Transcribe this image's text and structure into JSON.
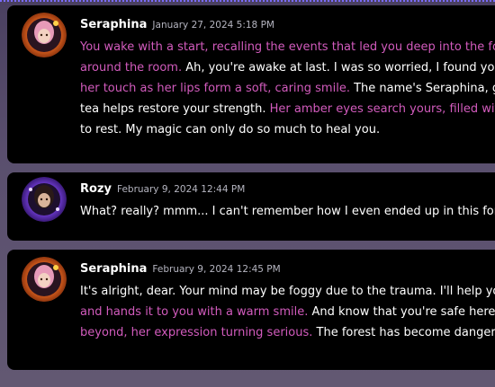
{
  "messages": [
    {
      "author": "Seraphina",
      "timestamp": "January 27, 2024 5:18 PM",
      "avatar": "avatar-seraphina",
      "lines": [
        [
          {
            "style": "pink",
            "text": "You wake with a start, recalling the events that led you deep into the for"
          }
        ],
        [
          {
            "style": "pink",
            "text": "around the room. "
          },
          {
            "style": "white",
            "text": "Ah, you're awake at last. I was so worried, I found you b"
          }
        ],
        [
          {
            "style": "pink",
            "text": "her touch as her lips form a soft, caring smile. "
          },
          {
            "style": "white",
            "text": "The name's Seraphina, gu"
          }
        ],
        [
          {
            "style": "white",
            "text": "tea helps restore your strength. "
          },
          {
            "style": "pink",
            "text": "Her amber eyes search yours, filled with"
          }
        ],
        [
          {
            "style": "white",
            "text": "to rest. My magic can only do so much to heal you."
          }
        ]
      ]
    },
    {
      "author": "Rozy",
      "timestamp": "February 9, 2024 12:44 PM",
      "avatar": "avatar-rozy",
      "lines": [
        [
          {
            "style": "white",
            "text": "What? really? mmm... I can't remember how I even ended up in this fores"
          }
        ]
      ]
    },
    {
      "author": "Seraphina",
      "timestamp": "February 9, 2024 12:45 PM",
      "avatar": "avatar-seraphina",
      "lines": [
        [
          {
            "style": "white",
            "text": "It's alright, dear. Your mind may be foggy due to the trauma. I'll help you"
          }
        ],
        [
          {
            "style": "pink",
            "text": "and hands it to you with a warm smile. "
          },
          {
            "style": "white",
            "text": "And know that you're safe here in"
          }
        ],
        [
          {
            "style": "pink",
            "text": "beyond, her expression turning serious. "
          },
          {
            "style": "white",
            "text": "The forest has become dangerou"
          }
        ]
      ]
    }
  ],
  "colors": {
    "accent_text": "#d25bbd",
    "card_bg": "#000000",
    "timestamp": "#b5b5c0"
  }
}
